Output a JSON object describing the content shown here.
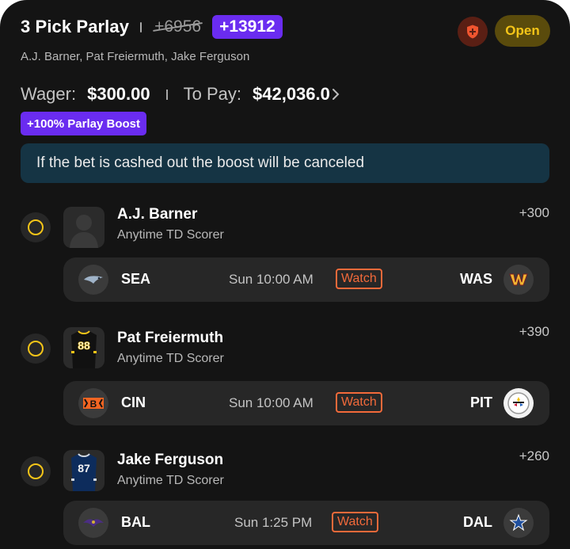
{
  "header": {
    "title": "3 Pick Parlay",
    "original_odds": "+6956",
    "boosted_odds": "+13912",
    "status": "Open",
    "players_summary": "A.J. Barner, Pat Freiermuth, Jake Ferguson"
  },
  "wager": {
    "wager_label": "Wager:",
    "wager_value": "$300.00",
    "to_pay_label": "To Pay:",
    "to_pay_value": "$42,036.0"
  },
  "boost_badge": "+100% Parlay Boost",
  "cashout_note": "If the bet is cashed out the boost will be canceled",
  "legs": [
    {
      "player": "A.J. Barner",
      "market": "Anytime TD Scorer",
      "odds": "+300",
      "jersey": "",
      "game": {
        "away": "SEA",
        "time": "Sun 10:00 AM",
        "watch": "Watch",
        "home": "WAS"
      }
    },
    {
      "player": "Pat Freiermuth",
      "market": "Anytime TD Scorer",
      "odds": "+390",
      "jersey": "88",
      "game": {
        "away": "CIN",
        "time": "Sun 10:00 AM",
        "watch": "Watch",
        "home": "PIT"
      }
    },
    {
      "player": "Jake Ferguson",
      "market": "Anytime TD Scorer",
      "odds": "+260",
      "jersey": "87",
      "game": {
        "away": "BAL",
        "time": "Sun 1:25 PM",
        "watch": "Watch",
        "home": "DAL"
      }
    }
  ],
  "colors": {
    "background": "#141414",
    "boost_purple": "#6a2cf0",
    "status_yellow": "#f5c518",
    "watch_orange": "#f36a3a",
    "note_bg": "#153444"
  },
  "icons": {
    "cashout": "shield-plus-icon",
    "radio": "radio-unselected-icon",
    "to_pay_more": "chevron-right-icon"
  }
}
